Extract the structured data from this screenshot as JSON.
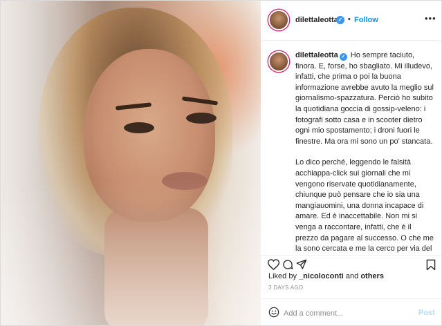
{
  "post": {
    "username": "dilettaleotta",
    "verified_mark": "✓",
    "separator": "•",
    "follow_label": "Follow",
    "more_label": "•••",
    "caption_paragraphs": [
      "Ho sempre taciuto, finora. E, forse, ho sbagliato. Mi illudevo, infatti, che prima o poi la buona informazione avrebbe avuto la meglio sul giornalismo-spazzatura. Perciò ho subito la quotidiana goccia di gossip-veleno: i fotografi sotto casa e in scooter dietro ogni mio spostamento; i droni fuori le finestre. Ma ora mi sono un po' stancata.",
      "Lo dico perché, leggendo le falsità acchiappa-click sui giornali che mi vengono riservate quotidianamente, chiunque può pensare che io sia una mangiauomini, una donna incapace di amare. Ed è inaccettabile. Non mi si venga a raccontare, infatti, che è il prezzo da pagare al successo. O che me la sono cercata e me la cerco per via del trucco, delle forme, degli abiti"
    ],
    "liked_prefix": "Liked by",
    "liked_user": "_nicoloconti",
    "liked_and": "and",
    "liked_others": "others",
    "timestamp": "3 DAYS AGO",
    "comment_placeholder": "Add a comment...",
    "post_label": "Post"
  },
  "icons": {
    "like": "heart-icon",
    "comment": "comment-bubble-icon",
    "share": "paper-plane-icon",
    "save": "bookmark-icon",
    "emoji": "emoji-smile-icon"
  },
  "colors": {
    "link_blue": "#0095f6",
    "verified_blue": "#3897f0",
    "post_disabled": "#b2dffc",
    "muted_text": "#8e8e8e",
    "story_ring": "#d62976"
  }
}
